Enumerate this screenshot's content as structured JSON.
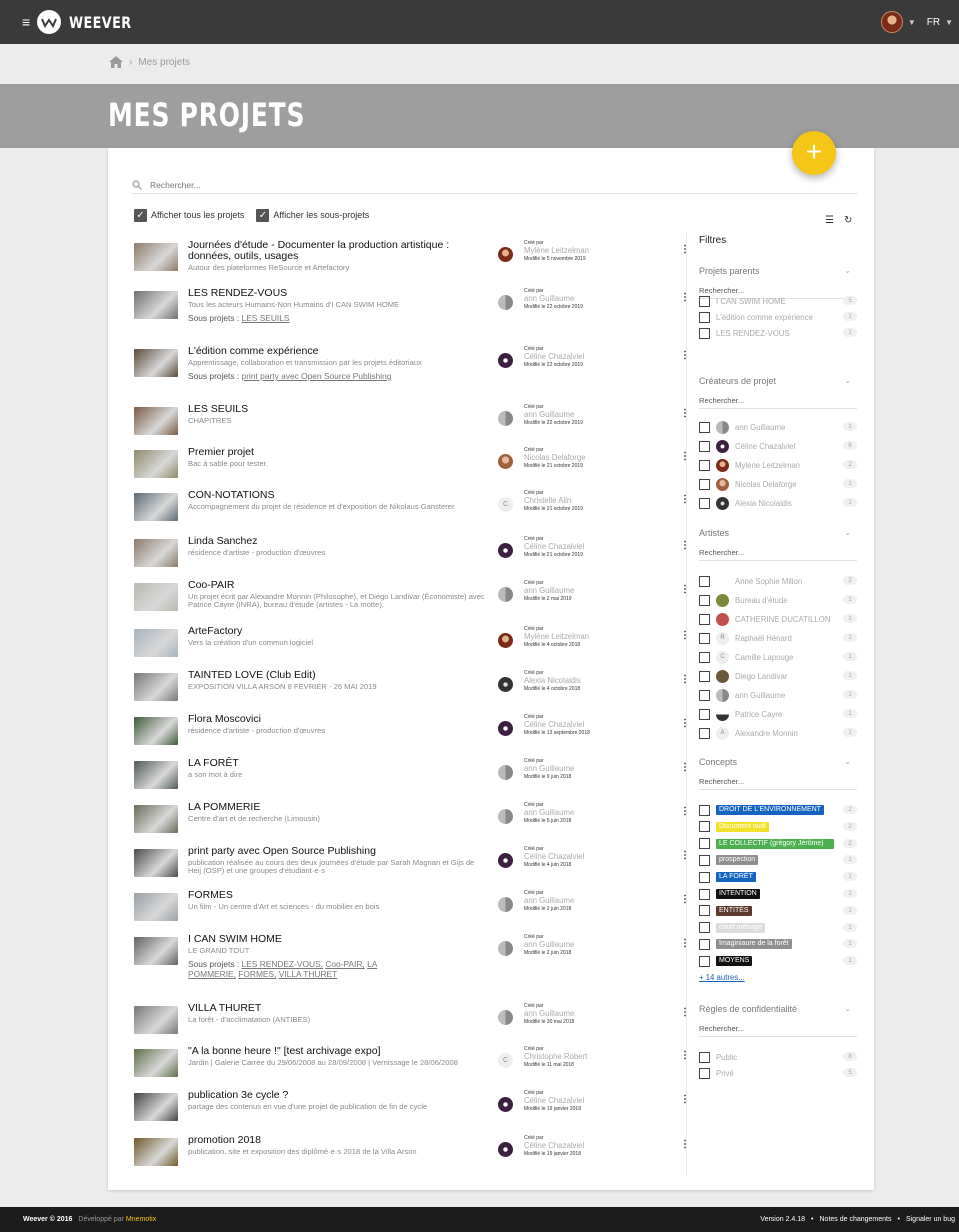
{
  "app": {
    "name": "WEEVER",
    "lang": "FR"
  },
  "breadcrumb": {
    "current": "Mes projets"
  },
  "page": {
    "title": "MES PROJETS"
  },
  "search": {
    "placeholder": "Rechercher..."
  },
  "toggles": {
    "show_all": "Afficher tous les projets",
    "show_sub": "Afficher les sous-projets"
  },
  "sub_label": "Sous projets :",
  "projects": [
    {
      "title": "Journées d'étude - Documenter la production artistique : données, outils, usages",
      "desc": "Autour des plateformes ReSource et Artefactory",
      "subs": [],
      "created_label": "Créé par",
      "author": "Mylène Leitzelman",
      "modified": "Modifié le 5 novembre 2019"
    },
    {
      "title": "LES RENDEZ-VOUS",
      "desc": "Tous les acteurs Humains-Non Humains d'I CAN SWIM HOME",
      "subs": [
        "LES SEUILS"
      ],
      "created_label": "Créé par",
      "author": "ann Guillaume",
      "modified": "Modifié le 22 octobre 2019"
    },
    {
      "title": "L'édition comme expérience",
      "desc": "Apprentissage, collaboration et transmission par les projets éditoriaux",
      "subs": [
        "print party avec Open Source Publishing"
      ],
      "created_label": "Créé par",
      "author": "Céline Chazalviel",
      "modified": "Modifié le 22 octobre 2019"
    },
    {
      "title": "LES SEUILS",
      "desc": "CHAPITRES",
      "subs": [],
      "created_label": "Créé par",
      "author": "ann Guillaume",
      "modified": "Modifié le 22 octobre 2019"
    },
    {
      "title": "Premier projet",
      "desc": "Bac à sable pour tester.",
      "subs": [],
      "created_label": "Créé par",
      "author": "Nicolas Delaforge",
      "modified": "Modifié le 21 octobre 2019"
    },
    {
      "title": "CON-NOTATIONS",
      "desc": "Accompagnement du projet de résidence et d'exposition de Nikolaus Gansterer",
      "subs": [],
      "created_label": "Créé par",
      "author": "Christelle Alin",
      "modified": "Modifié le 21 octobre 2019"
    },
    {
      "title": "Linda Sanchez",
      "desc": "résidence d'artiste - production d'œuvres",
      "subs": [],
      "created_label": "Créé par",
      "author": "Céline Chazalviel",
      "modified": "Modifié le 21 octobre 2019"
    },
    {
      "title": "Coo-PAIR",
      "desc": "Un projet écrit par Alexandre Monnin (Philosophe), et Diégo Landivar (Économiste) avec Patrice Cayre (INRA), bureau d'étude (artistes - La motte).",
      "subs": [],
      "created_label": "Créé par",
      "author": "ann Guillaume",
      "modified": "Modifié le 2 mai 2019"
    },
    {
      "title": "ArteFactory",
      "desc": "Vers la création d'un commun logiciel",
      "subs": [],
      "created_label": "Créé par",
      "author": "Mylène Leitzelman",
      "modified": "Modifié le 4 octobre 2018"
    },
    {
      "title": "TAINTED LOVE (Club Edit)",
      "desc": "EXPOSITION VILLA ARSON 8 FÉVRIER - 26 MAI 2019",
      "subs": [],
      "created_label": "Créé par",
      "author": "Alexia Nicolaidis",
      "modified": "Modifié le 4 octobre 2018"
    },
    {
      "title": "Flora Moscovici",
      "desc": "résidence d'artiste - production d'œuvres",
      "subs": [],
      "created_label": "Créé par",
      "author": "Céline Chazalviel",
      "modified": "Modifié le 13 septembre 2018"
    },
    {
      "title": "LA FORÊT",
      "desc": "a son mot à dire",
      "subs": [],
      "created_label": "Créé par",
      "author": "ann Guillaume",
      "modified": "Modifié le 9 juin 2018"
    },
    {
      "title": "LA POMMERIE",
      "desc": "Centre d'art et de recherche (Limousin)",
      "subs": [],
      "created_label": "Créé par",
      "author": "ann Guillaume",
      "modified": "Modifié le 5 juin 2018"
    },
    {
      "title": "print party avec Open Source Publishing",
      "desc": "publication réalisée au cours des deux journées d'étude par Sarah Magnan et Gijs de Heij (OSP) et une groupes d'étudiant·e·s",
      "subs": [],
      "created_label": "Créé par",
      "author": "Céline Chazalviel",
      "modified": "Modifié le 4 juin 2018"
    },
    {
      "title": "FORMES",
      "desc": "Un film - Un centre d'Art et sciences - du mobilier en bois",
      "subs": [],
      "created_label": "Créé par",
      "author": "ann Guillaume",
      "modified": "Modifié le 2 juin 2018"
    },
    {
      "title": "I CAN SWIM HOME",
      "desc": "LE GRAND TOUT",
      "subs": [
        "LES RENDEZ-VOUS,",
        "Coo-PAIR,",
        "LA POMMERIE,",
        "FORMES,",
        "VILLA THURET"
      ],
      "created_label": "Créé par",
      "author": "ann Guillaume",
      "modified": "Modifié le 2 juin 2018"
    },
    {
      "title": "VILLA THURET",
      "desc": "La forêt - d'acclimatation (ANTIBES)",
      "subs": [],
      "created_label": "Créé par",
      "author": "ann Guillaume",
      "modified": "Modifié le 30 mai 2018"
    },
    {
      "title": "\"A la bonne heure !\" [test archivage expo]",
      "desc": "Jardin | Galerie Carrée du 29/06/2008 au 28/09/2008 | Vernissage le 28/06/2008",
      "subs": [],
      "created_label": "Créé par",
      "author": "Christophe Robert",
      "modified": "Modifié le 11 mai 2018"
    },
    {
      "title": "publication 3e cycle ?",
      "desc": "partage des contenus en vue d'une projet de publication de fin de cycle",
      "subs": [],
      "created_label": "Créé par",
      "author": "Céline Chazalviel",
      "modified": "Modifié le 19 janvier 2018"
    },
    {
      "title": "promotion 2018",
      "desc": "publication, site et exposition des diplômé·e·s 2018 de la Villa Arson",
      "subs": [],
      "created_label": "Créé par",
      "author": "Céline Chazalviel",
      "modified": "Modifié le 19 janvier 2018"
    }
  ],
  "filters": {
    "title": "Filtres",
    "search_placeholder": "Rechercher...",
    "parents": {
      "title": "Projets parents",
      "items": [
        {
          "label": "I CAN SWIM HOME",
          "count": "5"
        },
        {
          "label": "L'édition comme expérience",
          "count": "1"
        },
        {
          "label": "LES RENDEZ-VOUS",
          "count": "1"
        }
      ]
    },
    "creators": {
      "title": "Créateurs de projet",
      "items": [
        {
          "label": "ann Guillaume",
          "count": "1"
        },
        {
          "label": "Céline Chazalviel",
          "count": "6"
        },
        {
          "label": "Mylène Leitzelman",
          "count": "2"
        },
        {
          "label": "Nicolas Delaforge",
          "count": "1"
        },
        {
          "label": "Alexia Nicolaidis",
          "count": "1"
        }
      ]
    },
    "artists": {
      "title": "Artistes",
      "items": [
        {
          "label": "Anne Sophie Millon",
          "count": "2",
          "initial": ""
        },
        {
          "label": "Bureau d'étude",
          "count": "1",
          "initial": ""
        },
        {
          "label": "CATHERINE DUCATILLON",
          "count": "1",
          "initial": ""
        },
        {
          "label": "Raphaël Hénard",
          "count": "1",
          "initial": "R"
        },
        {
          "label": "Camille Lapouge",
          "count": "1",
          "initial": "C"
        },
        {
          "label": "Diego Landivar",
          "count": "1",
          "initial": ""
        },
        {
          "label": "ann Guillaume",
          "count": "1",
          "initial": ""
        },
        {
          "label": "Patrice Cayre",
          "count": "1",
          "initial": ""
        },
        {
          "label": "Alexandre Monnin",
          "count": "1",
          "initial": "A"
        }
      ]
    },
    "concepts": {
      "title": "Concepts",
      "more": "+ 14 autres...",
      "items": [
        {
          "label": "DROIT DE L'ENVIRONNEMENT",
          "count": "2",
          "color": "#1565c0"
        },
        {
          "label": "Document outil",
          "count": "2",
          "color": "#f2e12b"
        },
        {
          "label": "LE COLLECTIF (grégory Jérôme)",
          "count": "2",
          "color": "#4caf50"
        },
        {
          "label": "prospection",
          "count": "1",
          "color": "#8f8f8f"
        },
        {
          "label": "LA FORÊT",
          "count": "1",
          "color": "#1565c0"
        },
        {
          "label": "INTENTION",
          "count": "1",
          "color": "#111111"
        },
        {
          "label": "ENTITÉS",
          "count": "1",
          "color": "#5d3a2e"
        },
        {
          "label": "court métrage",
          "count": "1",
          "color": "#dcdcdc"
        },
        {
          "label": "Imaginiaure de la forêt",
          "count": "1",
          "color": "#8f8f8f"
        },
        {
          "label": "MOYENS",
          "count": "1",
          "color": "#111111"
        }
      ]
    },
    "privacy": {
      "title": "Règles de confidentialité",
      "items": [
        {
          "label": "Public",
          "count": "8"
        },
        {
          "label": "Privé",
          "count": "5"
        }
      ]
    }
  },
  "footer": {
    "brand": "Weever © 2016",
    "dev_prefix": "Développé par",
    "dev_name": "Mnemotix",
    "version": "Version 2.4.18",
    "sep": "•",
    "changes": "Notes de changements",
    "bug": "Signaler un bug"
  },
  "colors": {
    "accent": "#f5c518",
    "topbar": "#3a3a3a",
    "banner": "#9e9e9e"
  }
}
